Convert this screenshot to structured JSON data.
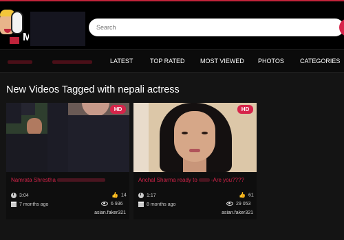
{
  "search": {
    "placeholder": "Search"
  },
  "nav": {
    "items": [
      {
        "label": "LATEST"
      },
      {
        "label": "TOP RATED"
      },
      {
        "label": "MOST VIEWED"
      },
      {
        "label": "PHOTOS"
      },
      {
        "label": "CATEGORIES"
      }
    ]
  },
  "page": {
    "heading": "New Videos Tagged with nepali actress"
  },
  "videos": [
    {
      "badge": "HD",
      "title_start": "Namrata Shrestha",
      "title_end": "",
      "duration": "3:04",
      "likes": "14",
      "age": "7 months ago",
      "views": "6 936",
      "uploader": "asian.faker321"
    },
    {
      "badge": "HD",
      "title_start": "Anchal Sharma ready to",
      "title_end": "-Are you????",
      "duration": "1:17",
      "likes": "61",
      "age": "8 months ago",
      "views": "29 053",
      "uploader": "asian.faker321"
    }
  ],
  "colors": {
    "accent": "#d6244a",
    "background": "#141414",
    "header": "#000000"
  }
}
